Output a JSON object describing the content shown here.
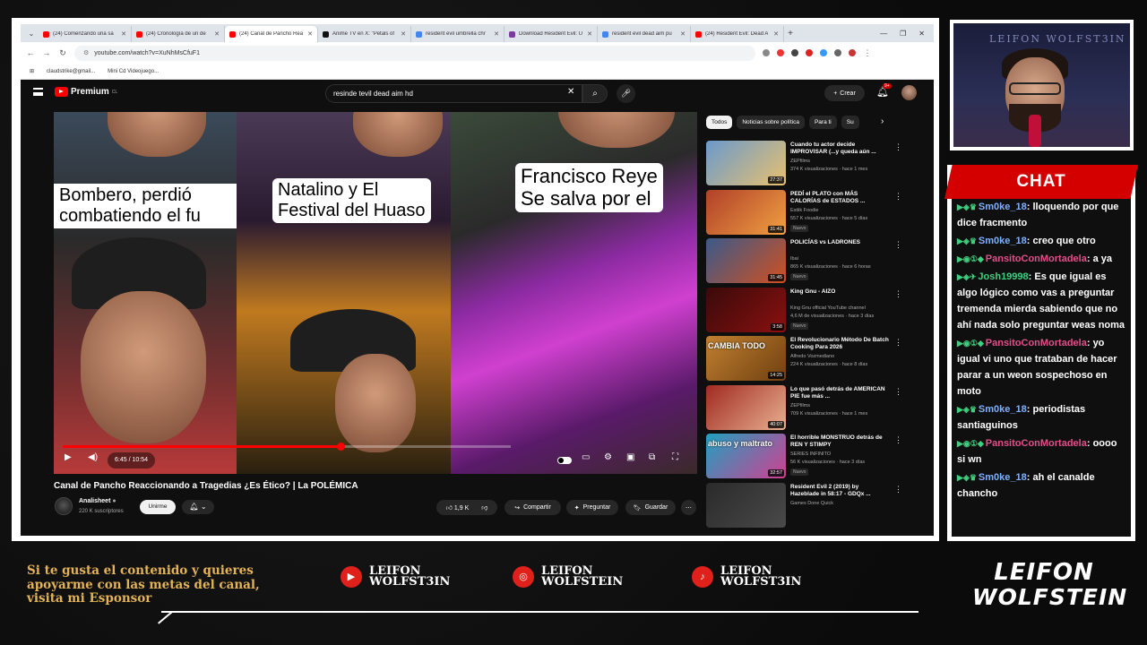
{
  "browser": {
    "tabs": [
      {
        "title": "(24) Comenzando una sa",
        "color": "#ff0000"
      },
      {
        "title": "(24) Cronología de un de",
        "color": "#ff0000"
      },
      {
        "title": "(24) Canal de Pancho Rea",
        "color": "#ff0000",
        "active": true
      },
      {
        "title": "Anime TV en X: \"Petals of",
        "color": "#111111"
      },
      {
        "title": "resident evil umbrella chr",
        "color": "#4285f4"
      },
      {
        "title": "Download Resident Evil: U",
        "color": "#7a3aa0"
      },
      {
        "title": "resident evil dead aim pu",
        "color": "#4285f4"
      },
      {
        "title": "(24) Resident Evil: Dead A",
        "color": "#ff0000"
      }
    ],
    "url": "youtube.com/watch?v=XuNhMsCfuF1",
    "bookmarks": [
      "claudstrike@gmail...",
      "Mini Cd Videojuego..."
    ]
  },
  "youtube": {
    "logo": "Premium",
    "logo_sup": "CL",
    "search_query": "resinde tevil dead aim hd",
    "create_label": "Crear",
    "notif_badge": "9+",
    "video": {
      "captions": [
        "Bombero, perdió combatiendo el fu",
        "Natalino y El Festival del Huaso",
        "Francisco Reye Se salva por el"
      ],
      "time": "6:45 / 10:54",
      "progress_fraction": 0.62,
      "title": "Canal de Pancho Reaccionando a Tragedias ¿Es Ético? | La POLÉMICA",
      "channel": "Analisheet",
      "subs": "220 K suscriptores",
      "join_label": "Unirme",
      "likes": "1,9 K",
      "share_label": "Compartir",
      "ask_label": "Preguntar",
      "save_label": "Guardar"
    },
    "chips": [
      "Todos",
      "Noticias sobre política",
      "Para ti",
      "Su"
    ],
    "recommendations": [
      {
        "title": "Cuando tu actor decide IMPROVISAR (...y queda aún ...",
        "channel": "ZEPfilms",
        "meta": "374 K visualizaciones · hace 1 mes",
        "duration": "27:37",
        "badge": "",
        "thumb_text": "",
        "colors": [
          "#6a9acb",
          "#e8c070"
        ]
      },
      {
        "title": "PEDÍ el PLATO con MÁS CALORÍAS de ESTADOS ...",
        "channel": "Estiik Foodie",
        "meta": "557 K visualizaciones · hace 5 días",
        "duration": "31:41",
        "badge": "Nuevo",
        "thumb_text": "",
        "colors": [
          "#b0402a",
          "#f0a040"
        ]
      },
      {
        "title": "POLICÍAS vs LADRONES",
        "channel": "Ibai",
        "meta": "865 K visualizaciones · hace 6 horas",
        "duration": "31:45",
        "badge": "Nuevo",
        "thumb_text": "",
        "colors": [
          "#3a5a8a",
          "#d05020"
        ]
      },
      {
        "title": "King Gnu - AIZO",
        "channel": "King Gnu official YouTube channel",
        "meta": "4,6 M de visualizaciones · hace 3 días",
        "duration": "3:58",
        "badge": "Nuevo",
        "thumb_text": "",
        "colors": [
          "#3a0a0a",
          "#8a1010"
        ]
      },
      {
        "title": "El Revolucionario Método De Batch Cooking Para 2026",
        "channel": "Alfredo Vozmediano",
        "meta": "224 K visualizaciones · hace 8 días",
        "duration": "14:25",
        "badge": "",
        "thumb_text": "CAMBIA TODO",
        "colors": [
          "#c08030",
          "#704010"
        ]
      },
      {
        "title": "Lo que pasó detrás de AMERICAN PIE fue más ...",
        "channel": "ZEPfilms",
        "meta": "709 K visualizaciones · hace 1 mes",
        "duration": "40:07",
        "badge": "",
        "thumb_text": "",
        "colors": [
          "#a02a20",
          "#e8b090"
        ]
      },
      {
        "title": "El horrible MONSTRUO detrás de REN Y STIMPY",
        "channel": "SERIES INFINITO",
        "meta": "56 K visualizaciones · hace 3 días",
        "duration": "32:57",
        "badge": "Nuevo",
        "thumb_text": "abuso y maltrato",
        "colors": [
          "#20a0c0",
          "#d04090"
        ]
      },
      {
        "title": "Resident Evil 2 (2019) by Hazeblade in 58:17 - GDQx ...",
        "channel": "Games Done Quick",
        "meta": "",
        "duration": "",
        "badge": "",
        "thumb_text": "",
        "colors": [
          "#2a2a2a",
          "#4a4a4a"
        ]
      }
    ]
  },
  "overlay": {
    "cam_logo": "LEIFON WOLFST3IN",
    "chat_title": "CHAT",
    "chat": [
      {
        "badges": "▶◈♛",
        "user": "Sm0ke_18",
        "color": "#7fb0ff",
        "text": ": lloquendo por que dice fracmento"
      },
      {
        "badges": "▶◈♛",
        "user": "Sm0ke_18",
        "color": "#7fb0ff",
        "text": ": creo que otro"
      },
      {
        "badges": "▶◉①◆",
        "user": "PansitoConMortadela",
        "color": "#e0508a",
        "text": ": a ya"
      },
      {
        "badges": "▶◈✈",
        "user": "Josh19998",
        "color": "#3fd07f",
        "text": ": Es que igual es algo lógico como vas a preguntar tremenda mierda sabiendo que no ahí nada solo preguntar weas noma"
      },
      {
        "badges": "▶◉①◆",
        "user": "PansitoConMortadela",
        "color": "#e0508a",
        "text": ": yo igual vi uno que trataban de hacer parar a un weon sospechoso en moto"
      },
      {
        "badges": "▶◈♛",
        "user": "Sm0ke_18",
        "color": "#7fb0ff",
        "text": ": periodistas santiaguinos"
      },
      {
        "badges": "▶◉①◆",
        "user": "PansitoConMortadela",
        "color": "#e0508a",
        "text": ": oooo si wn"
      },
      {
        "badges": "▶◈♛",
        "user": "Sm0ke_18",
        "color": "#7fb0ff",
        "text": ": ah el canalde chancho"
      }
    ],
    "sponsor_text": "Si te gusta el contenido y quieres apoyarme con las metas del canal, visita mi Esponsor",
    "socials": [
      {
        "platform": "youtube-icon",
        "glyph": "▶",
        "line1": "LEIFON",
        "line2": "WOLFST3IN"
      },
      {
        "platform": "instagram-icon",
        "glyph": "◎",
        "line1": "LEIFON",
        "line2": "WOLFSTEIN"
      },
      {
        "platform": "tiktok-icon",
        "glyph": "♪",
        "line1": "LEIFON",
        "line2": "WOLFST3IN"
      }
    ],
    "brand_line1": "LEIFON",
    "brand_line2": "WOLFSTEIN"
  }
}
